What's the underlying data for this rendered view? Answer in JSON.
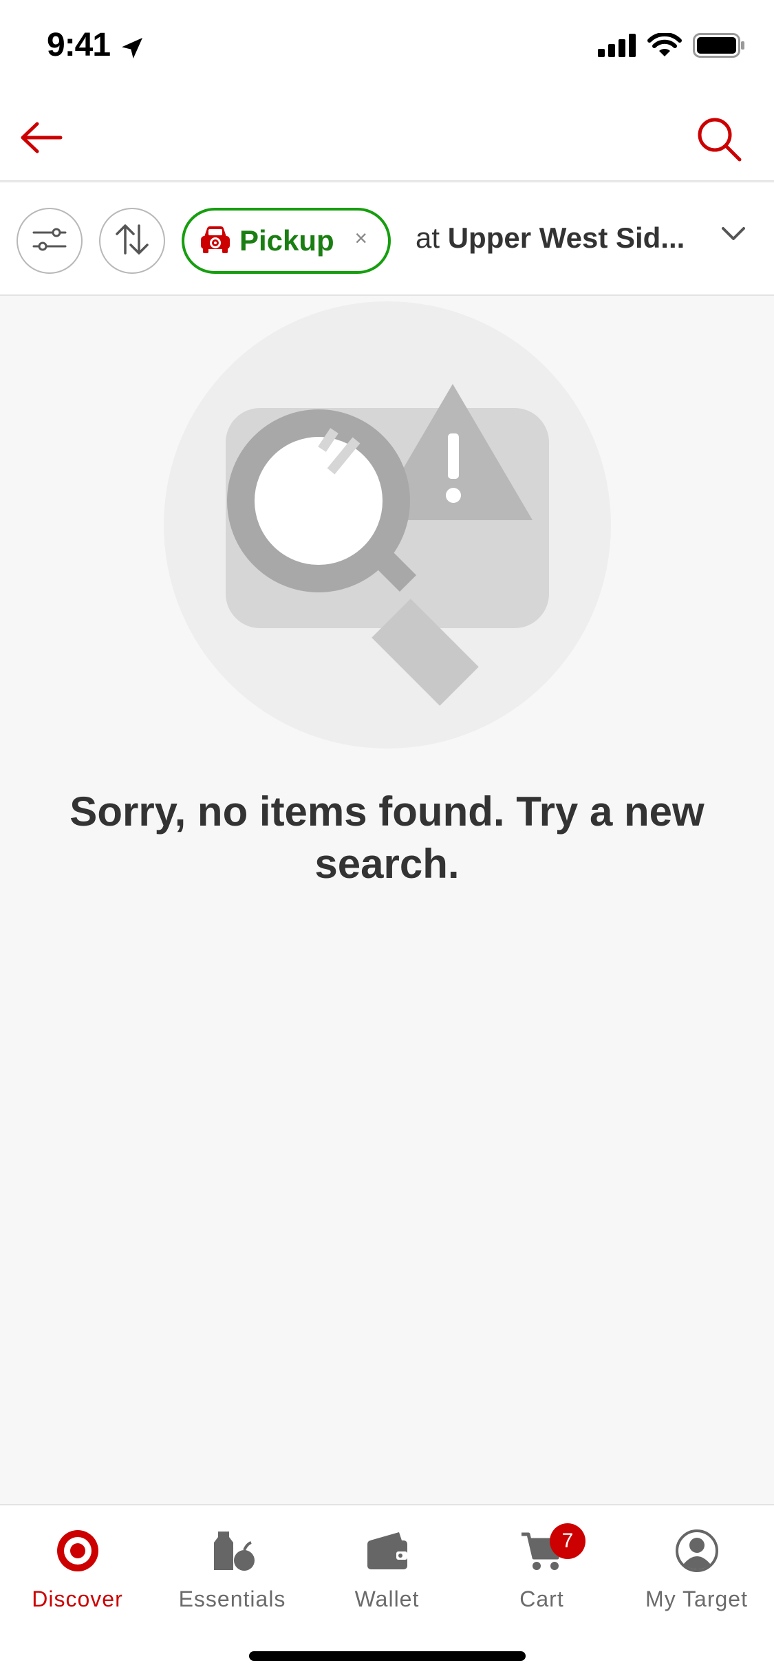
{
  "status_bar": {
    "time": "9:41"
  },
  "filter_bar": {
    "pickup_label": "Pickup",
    "pickup_close": "×",
    "store_prefix": "at ",
    "store_name": "Upper West Sid..."
  },
  "empty_state": {
    "message": "Sorry, no items found. Try a new search."
  },
  "tab_bar": {
    "tabs": [
      {
        "label": "Discover",
        "icon": "target-logo-icon",
        "active": true
      },
      {
        "label": "Essentials",
        "icon": "essentials-icon",
        "active": false
      },
      {
        "label": "Wallet",
        "icon": "wallet-icon",
        "active": false
      },
      {
        "label": "Cart",
        "icon": "cart-icon",
        "active": false,
        "badge": "7"
      },
      {
        "label": "My Target",
        "icon": "account-icon",
        "active": false
      }
    ]
  },
  "colors": {
    "brand_red": "#cc0000",
    "pickup_green": "#169e0f",
    "background": "#f7f7f7"
  }
}
